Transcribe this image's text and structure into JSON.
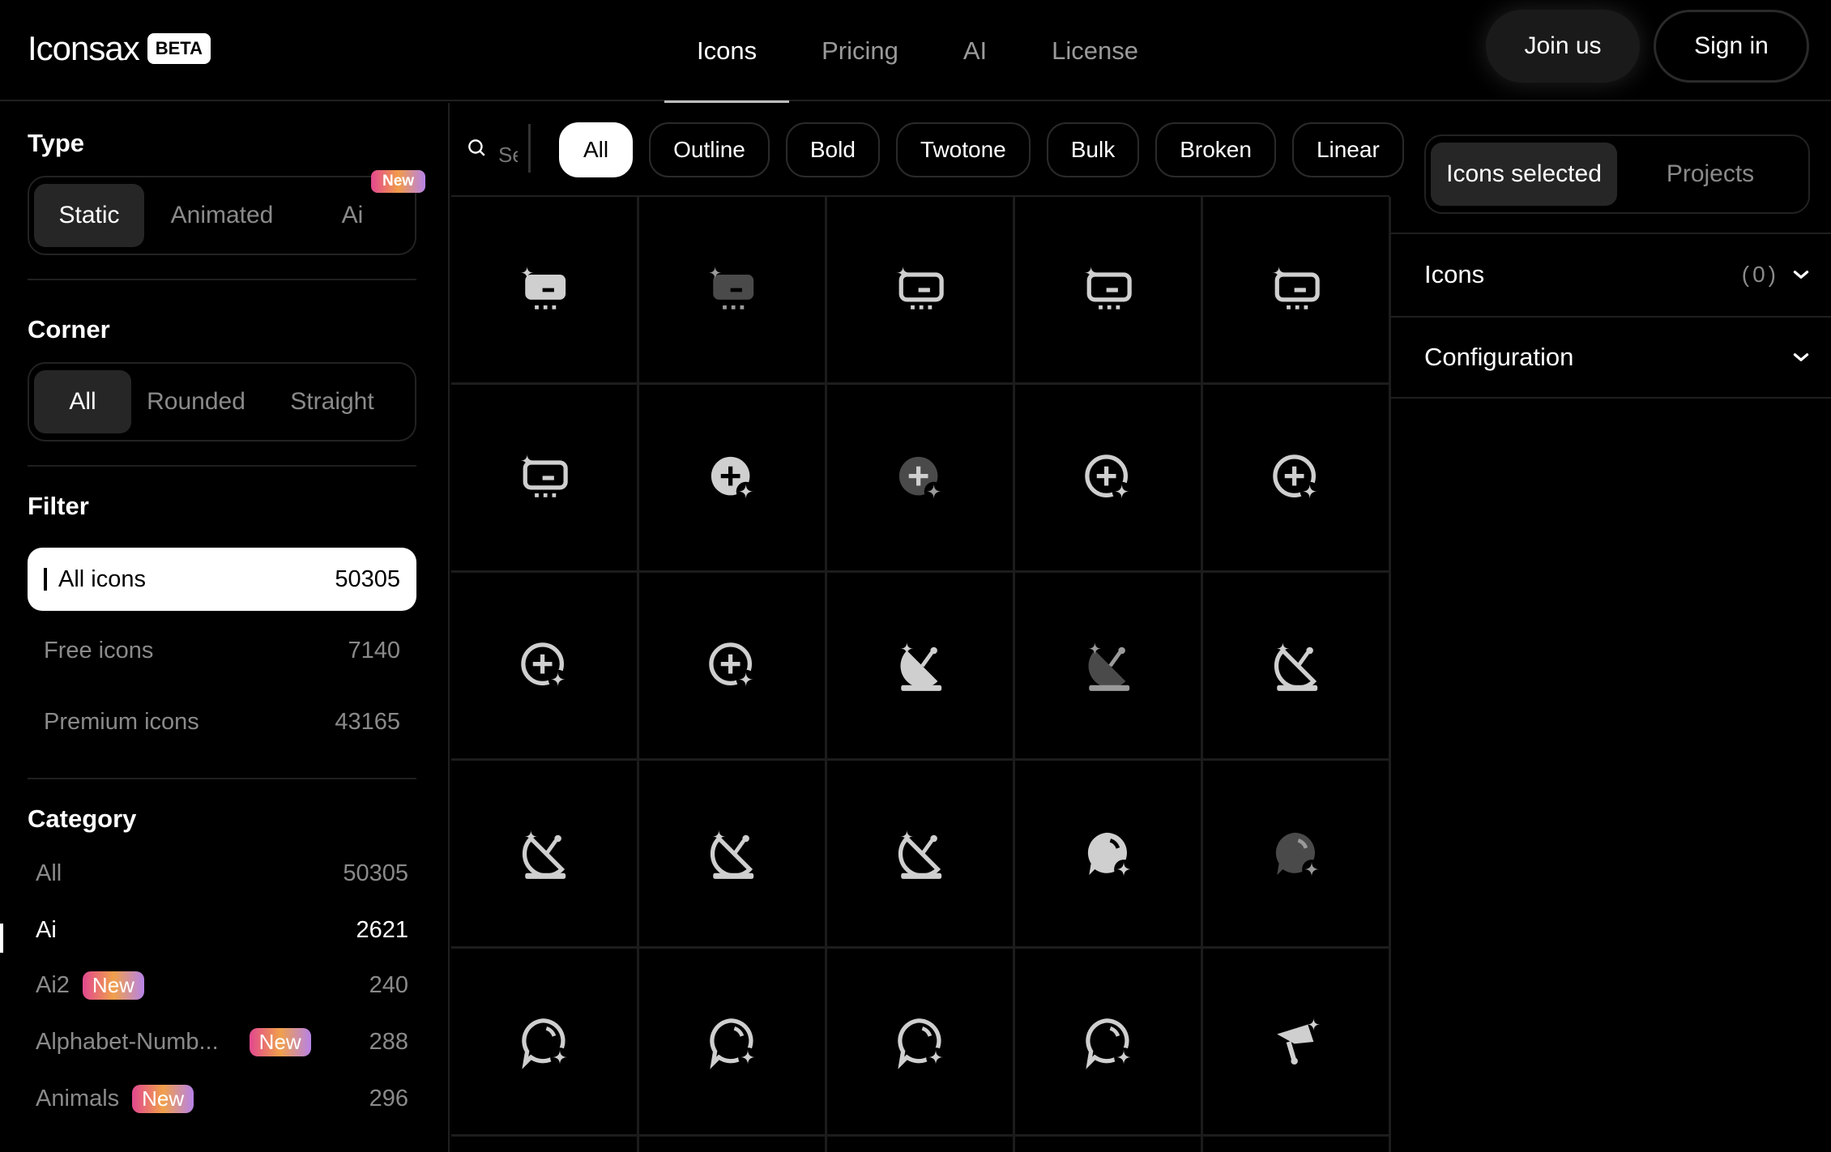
{
  "header": {
    "logo": "Iconsax",
    "beta": "BETA",
    "nav": [
      "Icons",
      "Pricing",
      "AI",
      "License"
    ],
    "join": "Join us",
    "signin": "Sign in"
  },
  "sidebar": {
    "type_title": "Type",
    "type_options": [
      "Static",
      "Animated",
      "Ai"
    ],
    "type_new": "New",
    "corner_title": "Corner",
    "corner_options": [
      "All",
      "Rounded",
      "Straight"
    ],
    "filter_title": "Filter",
    "filters": [
      {
        "label": "All icons",
        "count": "50305"
      },
      {
        "label": "Free icons",
        "count": "7140"
      },
      {
        "label": "Premium icons",
        "count": "43165"
      }
    ],
    "category_title": "Category",
    "categories": [
      {
        "label": "All",
        "count": "50305",
        "badge": ""
      },
      {
        "label": "Ai",
        "count": "2621",
        "badge": ""
      },
      {
        "label": "Ai2",
        "count": "240",
        "badge": "New"
      },
      {
        "label": "Alphabet-Numb...",
        "count": "288",
        "badge": "New"
      },
      {
        "label": "Animals",
        "count": "296",
        "badge": "New"
      }
    ]
  },
  "toolbar": {
    "search_placeholder": "Search",
    "styles": [
      "All",
      "Outline",
      "Bold",
      "Twotone",
      "Bulk",
      "Broken",
      "Linear"
    ]
  },
  "grid": {
    "icons": [
      "ai-card-bold-icon",
      "ai-card-bulk-icon",
      "ai-card-linear-icon",
      "ai-card-twotone-icon",
      "ai-card-broken-icon",
      "ai-card-outline-icon",
      "ai-add-circle-bold-icon",
      "ai-add-circle-bulk-icon",
      "ai-add-circle-linear-icon",
      "ai-add-circle-twotone-icon",
      "ai-add-circle-broken-icon",
      "ai-add-circle-outline-icon",
      "ai-satellite-bold-icon",
      "ai-satellite-bulk-icon",
      "ai-satellite-linear-icon",
      "ai-satellite-twotone-icon",
      "ai-satellite-broken-icon",
      "ai-satellite-outline-icon",
      "ai-chat-bold-icon",
      "ai-chat-bulk-icon",
      "ai-chat-linear-icon",
      "ai-chat-twotone-icon",
      "ai-chat-broken-icon",
      "ai-chat-outline-icon",
      "ai-fan-bold-icon"
    ]
  },
  "right": {
    "tabs": [
      "Icons selected",
      "Projects"
    ],
    "icons_title": "Icons",
    "icons_count": "(0)",
    "config_title": "Configuration"
  }
}
